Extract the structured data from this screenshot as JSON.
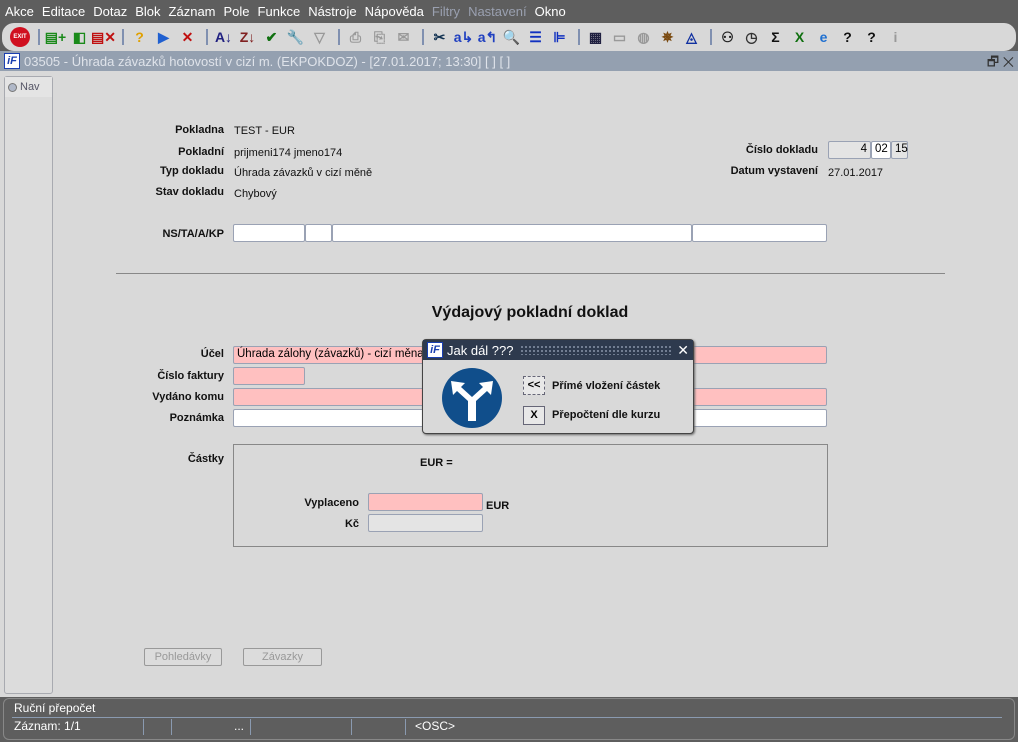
{
  "menu": [
    "Akce",
    "Editace",
    "Dotaz",
    "Blok",
    "Záznam",
    "Pole",
    "Funkce",
    "Nástroje",
    "Nápověda",
    "Filtry",
    "Nastavení",
    "Okno"
  ],
  "menu_disabled": [
    "Filtry",
    "Nastavení"
  ],
  "toolbar": [
    {
      "icon": "exit-icon",
      "glyph": "EXIT",
      "color": "#d01020"
    },
    {
      "sep": true
    },
    {
      "icon": "insert-record-icon",
      "glyph": "▤+",
      "color": "#1a8a1a"
    },
    {
      "icon": "duplicate-record-icon",
      "glyph": "◧",
      "color": "#1a8a1a"
    },
    {
      "icon": "delete-record-icon",
      "glyph": "▤✕",
      "color": "#c01010"
    },
    {
      "sep": true
    },
    {
      "icon": "query-help-icon",
      "glyph": "?",
      "color": "#e0a000"
    },
    {
      "icon": "execute-query-icon",
      "glyph": "▶",
      "color": "#2060d0"
    },
    {
      "icon": "cancel-query-icon",
      "glyph": "✕",
      "color": "#c01010"
    },
    {
      "sep": true
    },
    {
      "icon": "sort-asc-icon",
      "glyph": "A↓",
      "color": "#202080"
    },
    {
      "icon": "sort-desc-icon",
      "glyph": "Z↓",
      "color": "#802020"
    },
    {
      "icon": "check-icon",
      "glyph": "✔",
      "color": "#107010"
    },
    {
      "icon": "wrench-icon",
      "glyph": "🔧",
      "color": "#999"
    },
    {
      "icon": "filter-icon",
      "glyph": "▽",
      "color": "#999"
    },
    {
      "sep": true
    },
    {
      "icon": "print-icon",
      "glyph": "⎙",
      "color": "#999"
    },
    {
      "icon": "print-setup-icon",
      "glyph": "⎘",
      "color": "#999"
    },
    {
      "icon": "mail-icon",
      "glyph": "✉",
      "color": "#999"
    },
    {
      "sep": true
    },
    {
      "icon": "cut-icon",
      "glyph": "✂",
      "color": "#103050"
    },
    {
      "icon": "copy-icon",
      "glyph": "a↳",
      "color": "#2040c0"
    },
    {
      "icon": "paste-icon",
      "glyph": "a↰",
      "color": "#2040c0"
    },
    {
      "icon": "search-icon",
      "glyph": "🔍",
      "color": "#2060a0"
    },
    {
      "icon": "list-icon",
      "glyph": "☰",
      "color": "#1030c0"
    },
    {
      "icon": "tree-list-icon",
      "glyph": "⊫",
      "color": "#1030c0"
    },
    {
      "sep": true
    },
    {
      "icon": "form-icon",
      "glyph": "▦",
      "color": "#202040"
    },
    {
      "icon": "document-icon",
      "glyph": "▭",
      "color": "#999"
    },
    {
      "icon": "globe-icon",
      "glyph": "◍",
      "color": "#999"
    },
    {
      "icon": "helm-icon",
      "glyph": "✵",
      "color": "#7a4a10"
    },
    {
      "icon": "eye-icon",
      "glyph": "◬",
      "color": "#1030a0"
    },
    {
      "sep": true
    },
    {
      "icon": "report-icon",
      "glyph": "⚇",
      "color": "#222"
    },
    {
      "icon": "clock-icon",
      "glyph": "◷",
      "color": "#333"
    },
    {
      "icon": "sum-icon",
      "glyph": "Σ",
      "color": "#111"
    },
    {
      "icon": "excel-icon",
      "glyph": "X",
      "color": "#107010"
    },
    {
      "icon": "browser-icon",
      "glyph": "e",
      "color": "#2070d0"
    },
    {
      "icon": "help-icon",
      "glyph": "?",
      "color": "#111"
    },
    {
      "icon": "context-help-icon",
      "glyph": "?",
      "color": "#111"
    },
    {
      "icon": "info-icon",
      "glyph": "i",
      "color": "#999"
    }
  ],
  "window": {
    "title": "03505 - Úhrada závazků hotovostí v cizí m. (EKPOKDOZ) - [27.01.2017; 13:30]  [ ]  [ ]",
    "logo": "iF"
  },
  "nav": {
    "label": "Nav"
  },
  "header": {
    "pokladna_label": "Pokladna",
    "pokladna": "TEST - EUR",
    "pokladni_label": "Pokladní",
    "pokladni": "prijmeni174 jmeno174",
    "typ_label": "Typ dokladu",
    "typ": "Úhrada závazků v cizí měně",
    "stav_label": "Stav dokladu",
    "stav": "Chybový",
    "cislo_label": "Číslo dokladu",
    "cislo": [
      "4",
      "02",
      "15"
    ],
    "datum_label": "Datum vystavení",
    "datum": "27.01.2017",
    "ns_label": "NS/TA/A/KP"
  },
  "form": {
    "heading": "Výdajový pokladní doklad",
    "ucel_label": "Účel",
    "ucel": "Úhrada zálohy (závazků) - cizí měna",
    "faktura_label": "Číslo faktury",
    "komu_label": "Vydáno komu",
    "poznamka_label": "Poznámka",
    "castky_label": "Částky",
    "eur_eq": "EUR  =",
    "vyplaceno_label": "Vyplaceno",
    "vyplaceno_unit": "EUR",
    "kc_label": "Kč",
    "btn_pohledavky": "Pohledávky",
    "btn_zavazky": "Závazky"
  },
  "dialog": {
    "title": "Jak dál ???",
    "icon": "fork-arrows-icon",
    "opt1_key": "<<",
    "opt1": "Přímé vložení částek",
    "opt2_key": "X",
    "opt2": "Přepočtení dle kurzu"
  },
  "status": {
    "message": "Ruční přepočet",
    "record": "Záznam: 1/1",
    "ellipsis": "...",
    "mode": "<OSC>"
  }
}
